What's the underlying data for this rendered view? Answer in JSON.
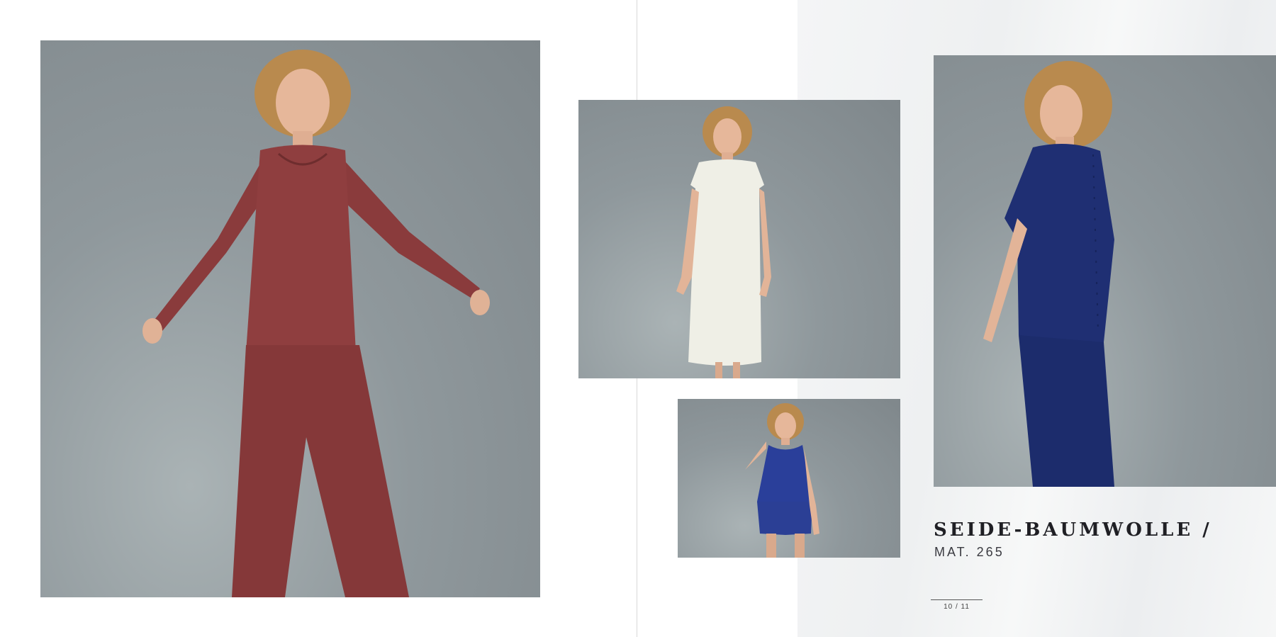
{
  "catalog": {
    "title": "SEIDE-BAUMWOLLE /",
    "material": "MAT. 265",
    "page_indicator": "10 / 11"
  },
  "photos": [
    {
      "name": "model-red-long-sleeve-pajama",
      "garment_color": "#8a3b3c"
    },
    {
      "name": "model-cream-nightdress",
      "garment_color": "#efefe6"
    },
    {
      "name": "model-blue-tank-shorts",
      "garment_color": "#2a3f9a"
    },
    {
      "name": "model-navy-tee-leggings",
      "garment_color": "#1f2f73"
    }
  ],
  "colors": {
    "background": "#ffffff",
    "photo_backdrop": "#8c9599",
    "title_text": "#1f1f24"
  }
}
